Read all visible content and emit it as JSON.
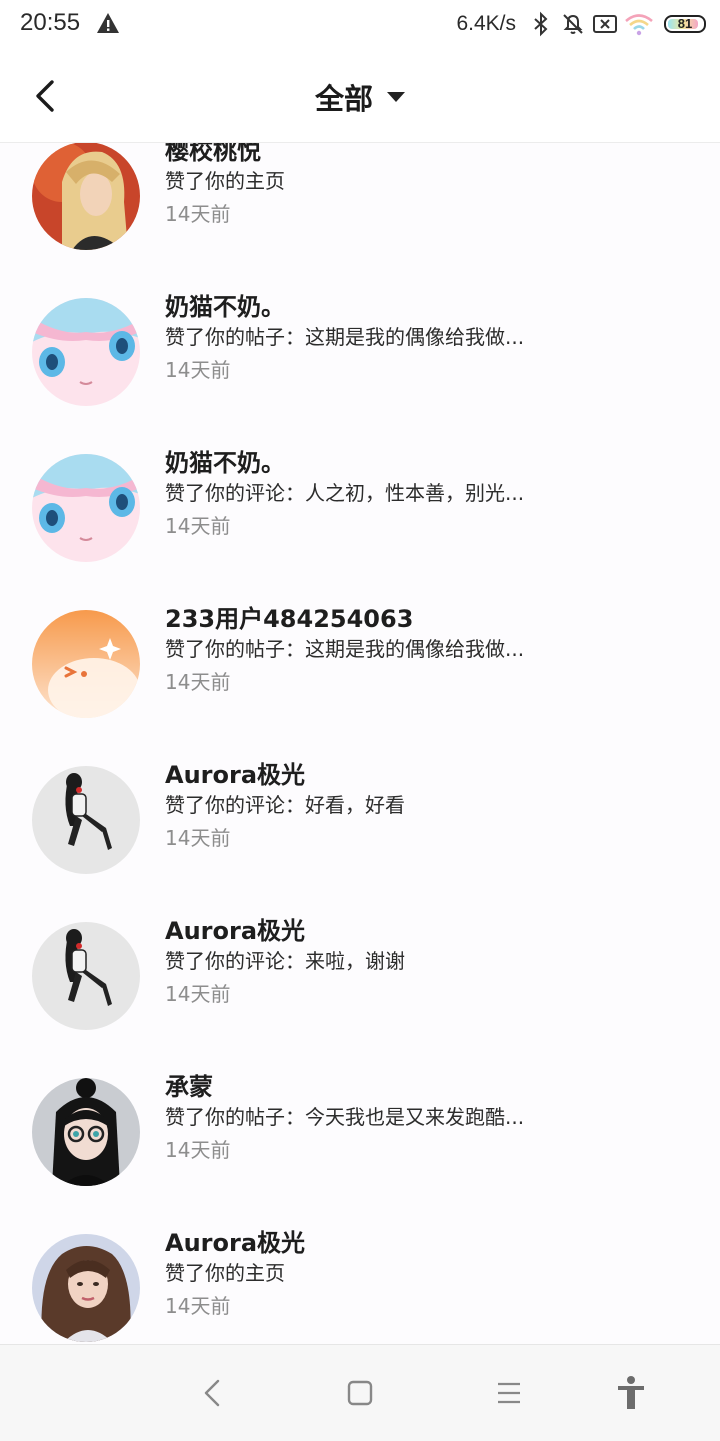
{
  "status_bar": {
    "time": "20:55",
    "net_speed": "6.4K/s",
    "battery_level": "81",
    "icons": [
      "warning-icon",
      "bluetooth-icon",
      "mute-bell-icon",
      "sim-blocked-icon",
      "wifi-icon",
      "battery-icon"
    ]
  },
  "header": {
    "title": "全部",
    "back_icon": "chevron-left-icon",
    "dropdown_icon": "caret-down-icon"
  },
  "notifications": [
    {
      "name": "樱校桃悦",
      "action": "赞了你的主页",
      "time": "14天前",
      "avatar": "blonde-girl"
    },
    {
      "name": "奶猫不奶。",
      "action": "赞了你的帖子：这期是我的偶像给我做...",
      "time": "14天前",
      "avatar": "anime-pink"
    },
    {
      "name": "奶猫不奶。",
      "action": "赞了你的评论：人之初，性本善，别光...",
      "time": "14天前",
      "avatar": "anime-pink"
    },
    {
      "name": "233用户484254063",
      "action": "赞了你的帖子：这期是我的偶像给我做...",
      "time": "14天前",
      "avatar": "orange-default"
    },
    {
      "name": "Aurora极光",
      "action": "赞了你的评论：好看，好看",
      "time": "14天前",
      "avatar": "chibi-character"
    },
    {
      "name": "Aurora极光",
      "action": "赞了你的评论：来啦，谢谢",
      "time": "14天前",
      "avatar": "chibi-character"
    },
    {
      "name": "承蒙",
      "action": "赞了你的帖子：今天我也是又来发跑酷...",
      "time": "14天前",
      "avatar": "glasses-girl"
    },
    {
      "name": "Aurora极光",
      "action": "赞了你的主页",
      "time": "14天前",
      "avatar": "curly-hair-girl"
    }
  ],
  "nav_bar": {
    "buttons": [
      "back-nav-icon",
      "home-square-icon",
      "menu-lines-icon",
      "accessibility-icon"
    ]
  },
  "colors": {
    "text_primary": "#1e1e1e",
    "text_secondary": "#8d8d8d",
    "orange_avatar": "#f7a05a"
  }
}
